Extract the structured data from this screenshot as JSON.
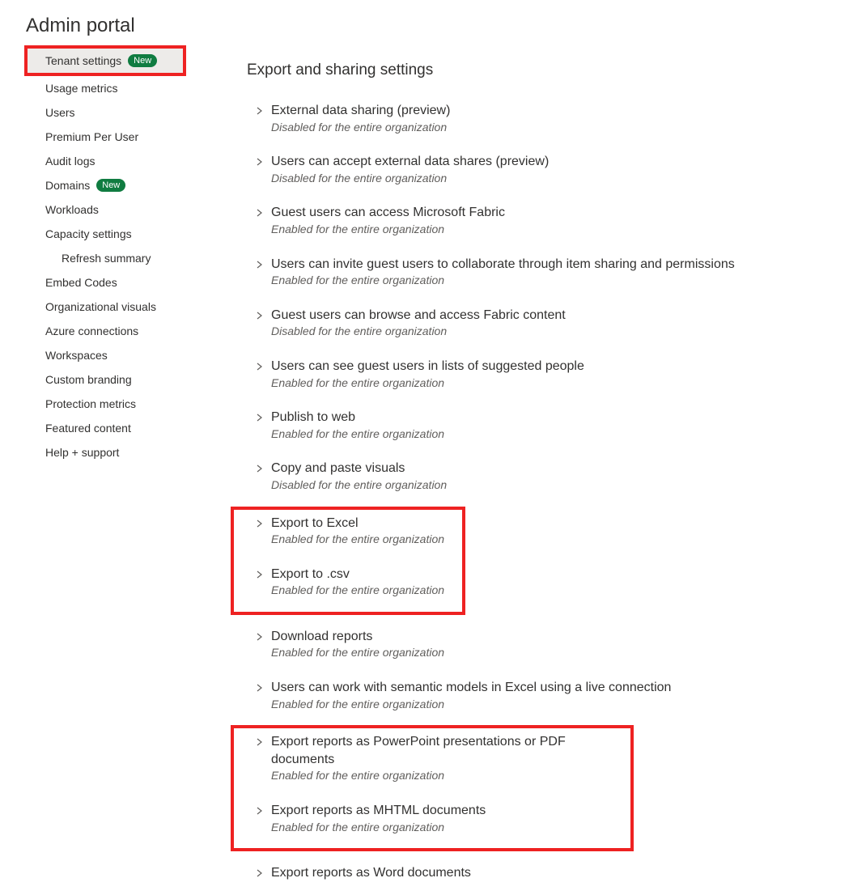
{
  "page_title": "Admin portal",
  "badge_new": "New",
  "sidebar": {
    "items": [
      {
        "label": "Tenant settings",
        "selected": true,
        "badge": true,
        "highlight": true
      },
      {
        "label": "Usage metrics"
      },
      {
        "label": "Users"
      },
      {
        "label": "Premium Per User"
      },
      {
        "label": "Audit logs"
      },
      {
        "label": "Domains",
        "badge": true
      },
      {
        "label": "Workloads"
      },
      {
        "label": "Capacity settings"
      },
      {
        "label": "Refresh summary",
        "nested": true
      },
      {
        "label": "Embed Codes"
      },
      {
        "label": "Organizational visuals"
      },
      {
        "label": "Azure connections"
      },
      {
        "label": "Workspaces"
      },
      {
        "label": "Custom branding"
      },
      {
        "label": "Protection metrics"
      },
      {
        "label": "Featured content"
      },
      {
        "label": "Help + support"
      }
    ]
  },
  "main": {
    "section_title": "Export and sharing settings",
    "status_enabled": "Enabled for the entire organization",
    "status_disabled": "Disabled for the entire organization",
    "settings": [
      {
        "title": "External data sharing (preview)",
        "enabled": false
      },
      {
        "title": "Users can accept external data shares (preview)",
        "enabled": false
      },
      {
        "title": "Guest users can access Microsoft Fabric",
        "enabled": true
      },
      {
        "title": "Users can invite guest users to collaborate through item sharing and permissions",
        "enabled": true
      },
      {
        "title": "Guest users can browse and access Fabric content",
        "enabled": false
      },
      {
        "title": "Users can see guest users in lists of suggested people",
        "enabled": true
      },
      {
        "title": "Publish to web",
        "enabled": true
      },
      {
        "title": "Copy and paste visuals",
        "enabled": false
      },
      {
        "title": "Export to Excel",
        "enabled": true,
        "hl": "a"
      },
      {
        "title": "Export to .csv",
        "enabled": true,
        "hl": "a"
      },
      {
        "title": "Download reports",
        "enabled": true
      },
      {
        "title": "Users can work with semantic models in Excel using a live connection",
        "enabled": true
      },
      {
        "title": "Export reports as PowerPoint presentations or PDF documents",
        "enabled": true,
        "hl": "b"
      },
      {
        "title": "Export reports as MHTML documents",
        "enabled": true,
        "hl": "b"
      },
      {
        "title": "Export reports as Word documents",
        "enabled": true,
        "cutoff": true
      }
    ]
  }
}
